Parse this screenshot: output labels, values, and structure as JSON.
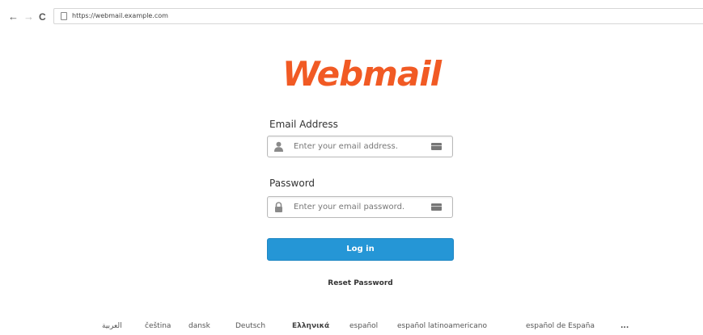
{
  "browser": {
    "back_glyph": "←",
    "forward_glyph": "→",
    "reload_glyph": "C",
    "url": "https://webmail.example.com"
  },
  "logo": {
    "text": "Webmail",
    "color": "#f15a24"
  },
  "form": {
    "email_label": "Email Address",
    "email_placeholder": "Enter your email address.",
    "email_value": "",
    "password_label": "Password",
    "password_placeholder": "Enter your email password.",
    "password_value": "",
    "login_label": "Log in",
    "login_color": "#2596d6",
    "reset_label": "Reset Password"
  },
  "languages": [
    "العربية",
    "čeština",
    "dansk",
    "Deutsch",
    "Ελληνικά",
    "español",
    "español latinoamericano",
    "español de España",
    "..."
  ],
  "icons": {
    "email_field": "user-icon",
    "password_field": "lock-icon",
    "field_trailing": "card-icon"
  }
}
